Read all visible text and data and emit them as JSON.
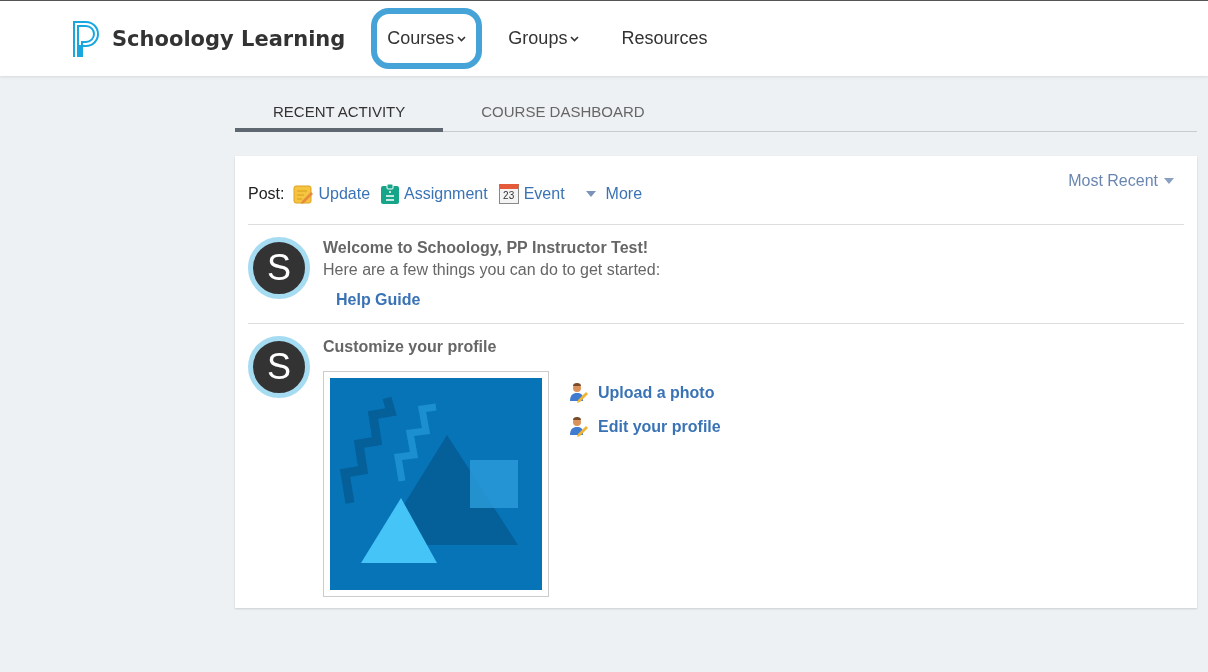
{
  "brand": {
    "name": "Schoology Learning"
  },
  "nav": [
    {
      "label": "Courses",
      "has_menu": true,
      "highlighted": true
    },
    {
      "label": "Groups",
      "has_menu": true,
      "highlighted": false
    },
    {
      "label": "Resources",
      "has_menu": false,
      "highlighted": false
    }
  ],
  "tabs": [
    {
      "label": "RECENT ACTIVITY",
      "selected": true
    },
    {
      "label": "COURSE DASHBOARD",
      "selected": false
    }
  ],
  "post": {
    "label": "Post:",
    "actions": [
      {
        "kind": "update",
        "label": "Update"
      },
      {
        "kind": "assignment",
        "label": "Assignment"
      },
      {
        "kind": "event",
        "label": "Event",
        "icon_text": "23"
      },
      {
        "kind": "more",
        "label": "More"
      }
    ]
  },
  "sort": {
    "label": "Most Recent"
  },
  "feed": [
    {
      "kind": "welcome",
      "avatar_letter": "S",
      "title": "Welcome to Schoology, PP Instructor Test!",
      "text": "Here are a few things you can do to get started:",
      "links": [
        "Help Guide"
      ]
    },
    {
      "kind": "profile",
      "avatar_letter": "S",
      "title": "Customize your profile",
      "links": [
        "Upload a photo",
        "Edit your profile"
      ]
    }
  ]
}
